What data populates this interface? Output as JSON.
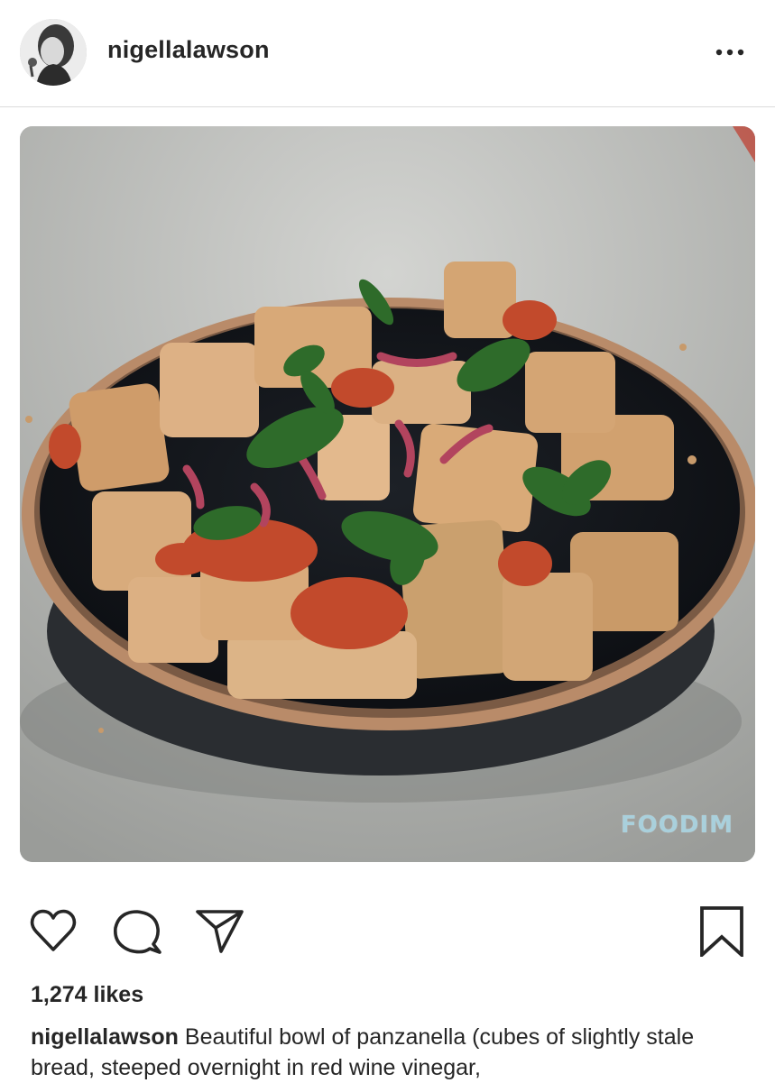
{
  "post": {
    "username": "nigellalawson",
    "image_watermark": "FOODIM",
    "likes": "1,274 likes",
    "caption_user": "nigellalawson",
    "caption_text": "Beautiful bowl of panzanella (cubes of slightly stale bread, steeped overnight in red wine vinegar,"
  },
  "icons": {
    "more": "more-options-icon",
    "like": "heart-icon",
    "comment": "comment-bubble-icon",
    "share": "paper-plane-icon",
    "save": "bookmark-icon"
  },
  "colors": {
    "text": "#262626",
    "divider": "#dbdbdb",
    "watermark": "#a9d0dc"
  }
}
